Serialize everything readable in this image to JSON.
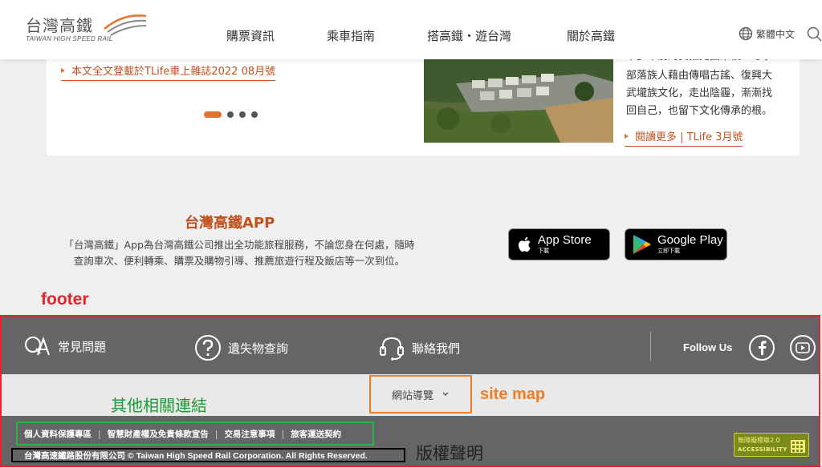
{
  "header": {
    "logo_cn": "台灣高鐵",
    "logo_en": "TAIWAN HIGH SPEED RAIL",
    "nav": [
      "購票資訊",
      "乘車指南",
      "搭高鐵・遊台灣",
      "關於高鐵"
    ],
    "language": "繁體中文"
  },
  "feature": {
    "left_link": "本文全文登載於TLife車上雜誌2022 08月號",
    "story_lines": [
      "卡多年前的異拉先國來校一等事",
      "部落族人藉由傳唱古謠、復興大",
      "武壠族文化，走出陰霾，漸漸找",
      "回自己，也留下文化傳承的根。"
    ],
    "right_link": "閱讀更多 | TLife 3月號"
  },
  "app": {
    "title": "台灣高鐵APP",
    "desc_line1": "「台灣高鐵」App為台灣高鐵公司推出全功能旅程服務，不論您身在何處，隨時",
    "desc_line2": "查詢車次、便利轉乘、購票及購物引導、推薦旅遊行程及飯店等一次到位。",
    "appstore_main": "App Store",
    "appstore_sub": "下載",
    "googleplay_main": "Google Play",
    "googleplay_sub": "立即下載"
  },
  "annotations": {
    "footer": "footer",
    "related_links": "其他相關連結",
    "site_map": "site map",
    "copyright": "版權聲明"
  },
  "footer": {
    "faq": "常見問題",
    "lost_found": "遺失物查詢",
    "contact": "聯絡我們",
    "follow_us": "Follow Us",
    "sitemap_label": "網站導覽",
    "links": [
      "個人資料保護專區",
      "智慧財產權及免責條款宣告",
      "交易注意事項",
      "旅客運送契約"
    ],
    "copyright": "台灣高速鐵路股份有限公司 © Taiwan High Speed Rail Corporation. All Rights Reserved.",
    "accessibility_top": "無障礙標章2.0",
    "accessibility_bottom": "ACCESSIBILITY"
  },
  "colors": {
    "accent": "#c2511f",
    "footer_bg": "#656565",
    "annotation_red": "#e8222b",
    "annotation_green": "#2cb34a",
    "annotation_orange": "#f07d22"
  }
}
